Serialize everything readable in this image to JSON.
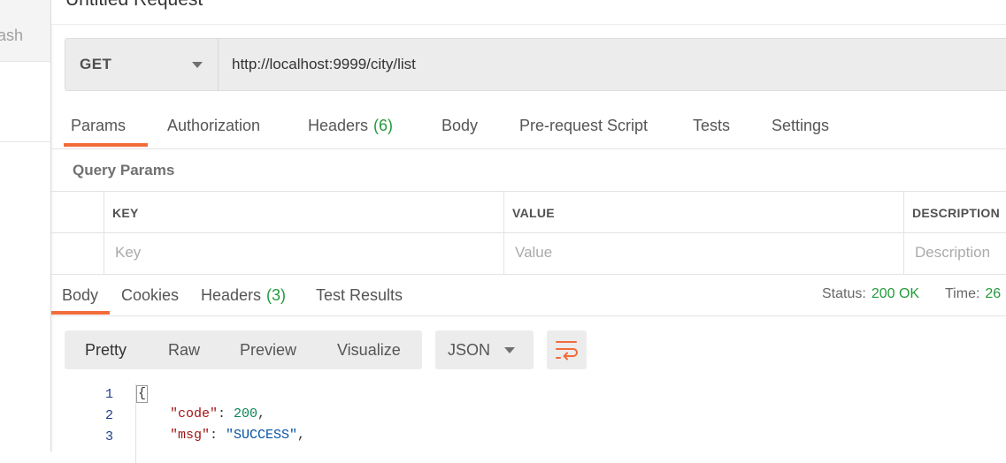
{
  "window": {
    "title": "Untitled Request"
  },
  "sidebar": {
    "partial_tab_text": "ash"
  },
  "request": {
    "method": "GET",
    "url": "http://localhost:9999/city/list",
    "tabs": {
      "params": "Params",
      "authorization": "Authorization",
      "headers": "Headers",
      "headers_count": "(6)",
      "body": "Body",
      "prerequest": "Pre-request Script",
      "tests": "Tests",
      "settings": "Settings"
    },
    "active_tab": "Params",
    "accent_color": "#f26b3a"
  },
  "query_params": {
    "label": "Query Params",
    "columns": {
      "key": "KEY",
      "value": "VALUE",
      "description": "DESCRIPTION"
    },
    "placeholders": {
      "key": "Key",
      "value": "Value",
      "description": "Description"
    }
  },
  "response": {
    "tabs": {
      "body": "Body",
      "cookies": "Cookies",
      "headers": "Headers",
      "headers_count": "(3)",
      "test_results": "Test Results"
    },
    "active_tab": "Body",
    "status_label": "Status:",
    "status_value": "200 OK",
    "time_label": "Time:",
    "time_value_partial": "26",
    "status_color": "#239a3c",
    "view_modes": {
      "pretty": "Pretty",
      "raw": "Raw",
      "preview": "Preview",
      "visualize": "Visualize"
    },
    "active_view": "Pretty",
    "format": "JSON",
    "icons": {
      "format_dropdown": "chevron-down-icon",
      "wrap": "wrap-lines-icon"
    }
  },
  "code": {
    "line_numbers": [
      "1",
      "2",
      "3"
    ],
    "line1": "{",
    "line2_key": "\"code\"",
    "line2_sep": ": ",
    "line2_val": "200",
    "line2_end": ",",
    "line3_key": "\"msg\"",
    "line3_sep": ": ",
    "line3_val": "\"SUCCESS\"",
    "line3_end": ","
  }
}
